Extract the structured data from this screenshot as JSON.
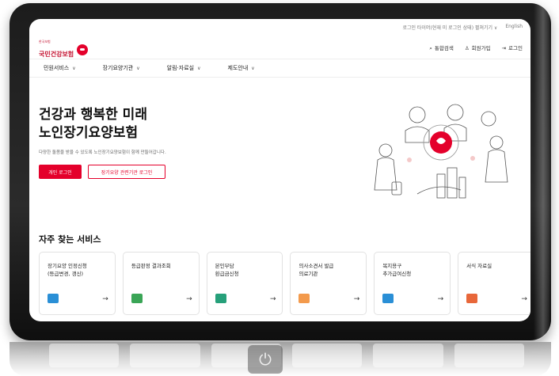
{
  "topbar": {
    "timer_text": "로그인 타이머(현재 미 로그인 상태) 펼쳐기기 ∨",
    "lang": "English"
  },
  "logo": {
    "small": "한국보험",
    "main": "국민건강보험"
  },
  "util": [
    {
      "icon": "search-icon",
      "glyph": "⌕",
      "label": "통합검색"
    },
    {
      "icon": "user-add-icon",
      "glyph": "♙",
      "label": "회원가입"
    },
    {
      "icon": "login-icon",
      "glyph": "⇥",
      "label": "로그인"
    }
  ],
  "nav": [
    {
      "label": "민원서비스"
    },
    {
      "label": "장기요양기관"
    },
    {
      "label": "알림·자료실"
    },
    {
      "label": "제도안내"
    }
  ],
  "hero": {
    "title_line1": "건강과 행복한 미래",
    "title_line2": "노인장기요양보험",
    "subtitle": "다양한 돌봄을 받을 수 있도록 노인장기요양보험이 함께 만들어갑니다.",
    "primary_btn": "개인 로그인",
    "secondary_btn": "장기요양 관련기관 로그인"
  },
  "services": {
    "title": "자주 찾는 서비스",
    "cards": [
      {
        "label": "장기요양 인정신청\n(등급변경, 갱신)",
        "icon": "document-check-icon",
        "color": "#2a8fd6"
      },
      {
        "label": "등급판정 결과조회",
        "icon": "clipboard-icon",
        "color": "#3aa556"
      },
      {
        "label": "본인부담\n환급금신청",
        "icon": "money-icon",
        "color": "#26a07a"
      },
      {
        "label": "의사소견서 발급\n의료기관",
        "icon": "hospital-icon",
        "color": "#f39a4c"
      },
      {
        "label": "복지용구\n추가급여신청",
        "icon": "bed-icon",
        "color": "#2a8fd6"
      },
      {
        "label": "서식 자료실",
        "icon": "form-icon",
        "color": "#e8673a"
      }
    ]
  },
  "brand_color": "#e4002b"
}
